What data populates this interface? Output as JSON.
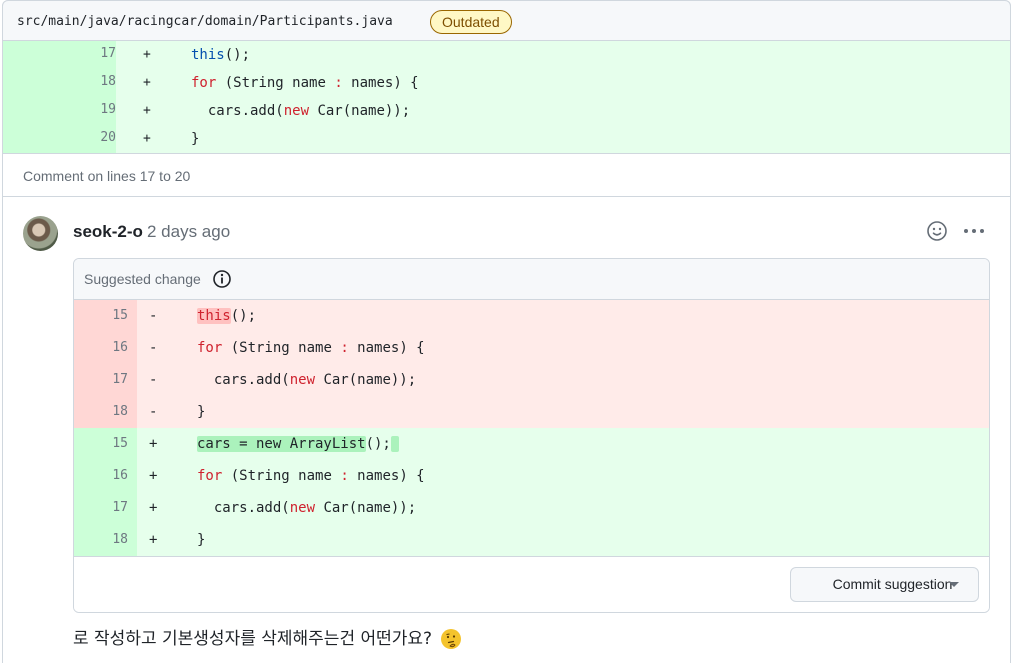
{
  "file": {
    "path": "src/main/java/racingcar/domain/Participants.java",
    "badge": "Outdated"
  },
  "context_lines": [
    {
      "num": "17",
      "sign": "+",
      "parts": [
        {
          "t": "this",
          "c": "blue"
        },
        {
          "t": "();",
          "c": ""
        }
      ]
    },
    {
      "num": "18",
      "sign": "+",
      "parts": [
        {
          "t": "for",
          "c": "red"
        },
        {
          "t": " (String name ",
          "c": ""
        },
        {
          "t": ":",
          "c": "red"
        },
        {
          "t": " names) {",
          "c": ""
        }
      ]
    },
    {
      "num": "19",
      "sign": "+",
      "parts": [
        {
          "t": "  cars.add(",
          "c": ""
        },
        {
          "t": "new",
          "c": "red"
        },
        {
          "t": " Car(name));",
          "c": ""
        }
      ]
    },
    {
      "num": "20",
      "sign": "+",
      "parts": [
        {
          "t": "}",
          "c": ""
        }
      ]
    }
  ],
  "comment_range": "Comment on lines 17 to 20",
  "comment": {
    "author": "seok-2-o",
    "timestamp": "2 days ago",
    "suggestion_title": "Suggested change",
    "deleted": [
      {
        "num": "15",
        "sign": "-",
        "parts": [
          {
            "t": "this",
            "c": "red",
            "hl": true
          },
          {
            "t": "();",
            "c": ""
          }
        ]
      },
      {
        "num": "16",
        "sign": "-",
        "parts": [
          {
            "t": "for",
            "c": "red"
          },
          {
            "t": " (String name ",
            "c": ""
          },
          {
            "t": ":",
            "c": "red"
          },
          {
            "t": " names) {",
            "c": ""
          }
        ]
      },
      {
        "num": "17",
        "sign": "-",
        "parts": [
          {
            "t": "  cars.add(",
            "c": ""
          },
          {
            "t": "new",
            "c": "red"
          },
          {
            "t": " Car(name));",
            "c": ""
          }
        ]
      },
      {
        "num": "18",
        "sign": "-",
        "parts": [
          {
            "t": "}",
            "c": ""
          }
        ]
      }
    ],
    "added": [
      {
        "num": "15",
        "sign": "+",
        "parts": [
          {
            "t": "cars = new ArrayList",
            "c": "",
            "hl": true
          },
          {
            "t": "();",
            "c": ""
          },
          {
            "t": " ",
            "c": "",
            "hl": true
          }
        ]
      },
      {
        "num": "16",
        "sign": "+",
        "parts": [
          {
            "t": "for",
            "c": "red"
          },
          {
            "t": " (String name ",
            "c": ""
          },
          {
            "t": ":",
            "c": "red"
          },
          {
            "t": " names) {",
            "c": ""
          }
        ]
      },
      {
        "num": "17",
        "sign": "+",
        "parts": [
          {
            "t": "  cars.add(",
            "c": ""
          },
          {
            "t": "new",
            "c": "red"
          },
          {
            "t": " Car(name));",
            "c": ""
          }
        ]
      },
      {
        "num": "18",
        "sign": "+",
        "parts": [
          {
            "t": "}",
            "c": ""
          }
        ]
      }
    ],
    "commit_button": "Commit suggestion",
    "body": "로 작성하고 기본생성자를 삭제해주는건 어떤가요?"
  }
}
